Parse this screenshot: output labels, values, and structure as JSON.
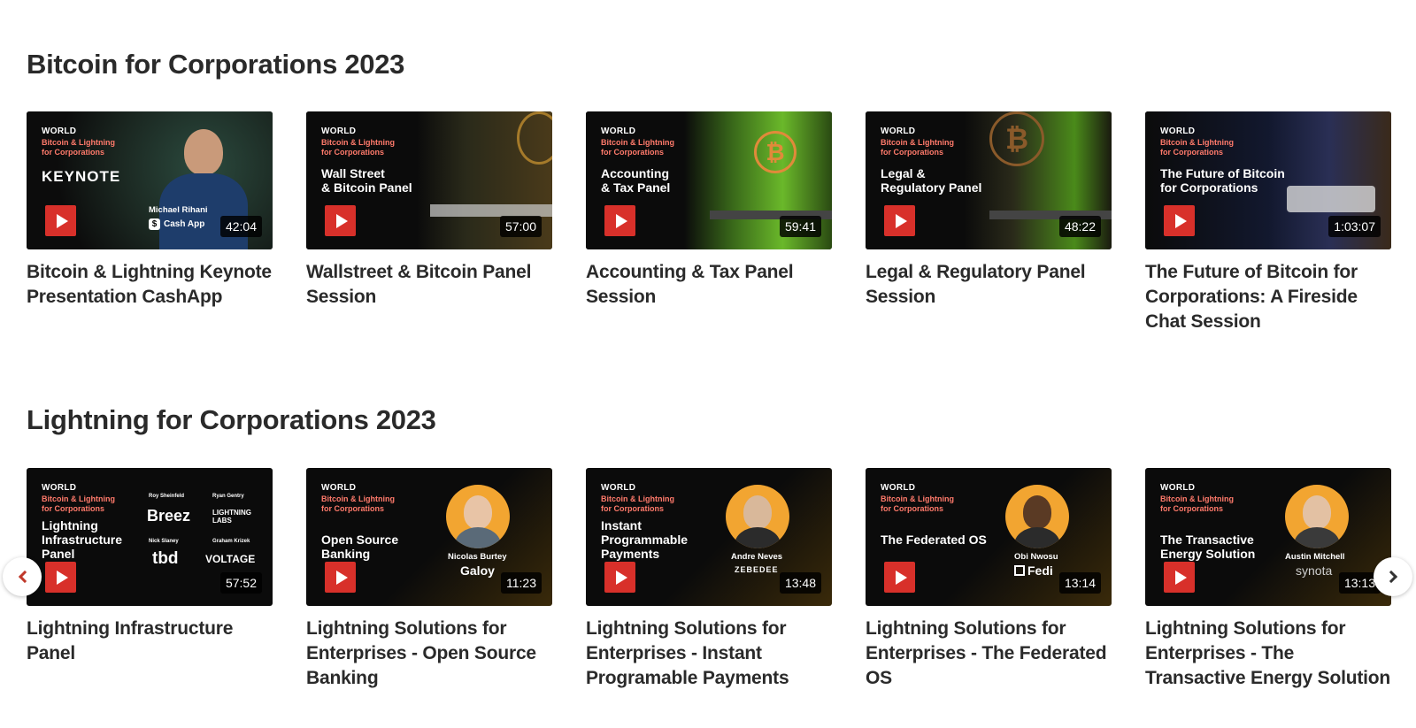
{
  "brand": {
    "world": "WORLD",
    "line1": "Bitcoin & Lightning",
    "line2": "for Corporations"
  },
  "sections": [
    {
      "title": "Bitcoin for Corporations 2023",
      "cards": [
        {
          "thumb_title": "KEYNOTE",
          "speaker": "Michael Rihani",
          "company": "Cash App",
          "duration": "42:04",
          "title": "Bitcoin & Lightning Keynote Presentation CashApp"
        },
        {
          "thumb_title": "Wall Street\n& Bitcoin Panel",
          "duration": "57:00",
          "title": "Wallstreet & Bitcoin Panel Session"
        },
        {
          "thumb_title": "Accounting\n& Tax Panel",
          "duration": "59:41",
          "title": "Accounting & Tax Panel Session"
        },
        {
          "thumb_title": "Legal &\nRegulatory Panel",
          "duration": "48:22",
          "title": "Legal & Regulatory Panel Session"
        },
        {
          "thumb_title": "The Future of Bitcoin\nfor Corporations",
          "duration": "1:03:07",
          "title": "The Future of Bitcoin for Corporations: A Fireside Chat Session"
        }
      ]
    },
    {
      "title": "Lightning for Corporations 2023",
      "cards": [
        {
          "thumb_title": "Lightning\nInfrastructure\nPanel",
          "logos": [
            "Roy Sheinfeld",
            "Breez",
            "Ryan Gentry",
            "LIGHTNING LABS",
            "Nick Slaney",
            "tbd",
            "Graham Krizek",
            "VOLTAGE"
          ],
          "duration": "57:52",
          "title": "Lightning Infrastructure Panel"
        },
        {
          "thumb_title": "Open Source\nBanking",
          "speaker": "Nicolas Burtey",
          "company": "Galoy",
          "duration": "11:23",
          "title": "Lightning Solutions for Enterprises - Open Source Banking"
        },
        {
          "thumb_title": "Instant\nProgrammable\nPayments",
          "speaker": "Andre Neves",
          "company": "ZEBEDEE",
          "duration": "13:48",
          "title": "Lightning Solutions for Enterprises - Instant Programable Payments"
        },
        {
          "thumb_title": "The Federated OS",
          "speaker": "Obi Nwosu",
          "company": "Fedi",
          "duration": "13:14",
          "title": "Lightning Solutions for Enterprises - The Federated OS"
        },
        {
          "thumb_title": "The Transactive\nEnergy Solution",
          "speaker": "Austin Mitchell",
          "company": "synota",
          "duration": "13:13",
          "title": "Lightning Solutions for Enterprises - The Transactive Energy Solution"
        }
      ]
    }
  ],
  "colors": {
    "play": "#d8302a",
    "accent_orange": "#f2a531",
    "bg": "#ffffff"
  },
  "icons": {
    "play": "play-icon",
    "prev": "chevron-left-icon",
    "next": "chevron-right-icon"
  }
}
